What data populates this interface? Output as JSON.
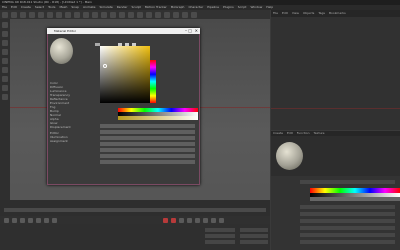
{
  "app": {
    "title": "CINEMA 4D R18.011 Studio (RC - R18) - [Untitled 1 *] - Main",
    "menu": [
      "File",
      "Edit",
      "Create",
      "Select",
      "Tools",
      "Mesh",
      "Snap",
      "Animate",
      "Simulate",
      "Render",
      "Sculpt",
      "Motion Tracker",
      "MoGraph",
      "Character",
      "Pipeline",
      "Plugins",
      "Script",
      "Window",
      "Help"
    ]
  },
  "object_manager": {
    "tabs": [
      "File",
      "Edit",
      "View",
      "Objects",
      "Tags",
      "Bookmarks"
    ]
  },
  "material_manager": {
    "tabs": [
      "Create",
      "Edit",
      "Function",
      "Texture"
    ]
  },
  "material_editor": {
    "title": "Material Editor",
    "window_controls": {
      "minimize": "–",
      "maximize": "□",
      "close": "✕"
    },
    "channels": [
      "Color",
      "Diffusion",
      "Luminance",
      "Transparency",
      "Reflectance",
      "Environment",
      "Fog",
      "Bump",
      "Normal",
      "Alpha",
      "Glow",
      "Displacement",
      "Editor",
      "Illumination",
      "Assignment"
    ]
  },
  "colors": {
    "accent": "#7b4a63",
    "record": "#b73a3a"
  }
}
